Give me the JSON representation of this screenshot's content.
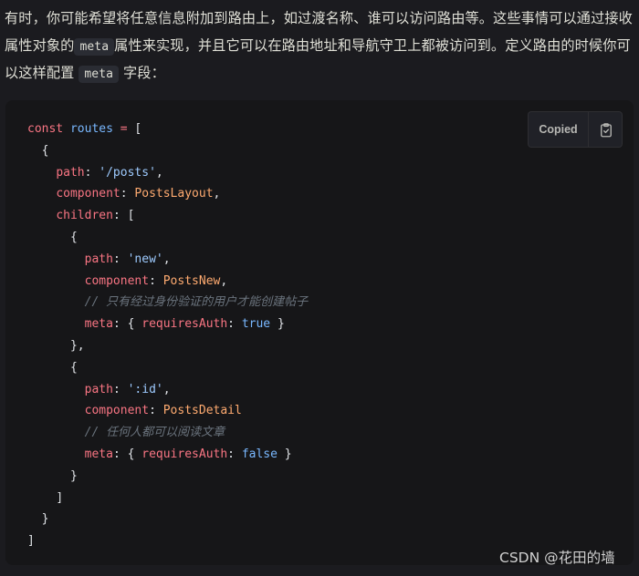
{
  "intro": {
    "line1_part1": "有时，你可能希望将任意信息附加到路由上，如过渡名称、谁可以访问路由等。这些事情可以通过接收属性对象的",
    "inline_code_1": "meta",
    "line2_part2": "属性来实现，并且它可以在路由地址和导航守卫上都被访问到。定义路由的时候你可以这样配置 ",
    "inline_code_2": "meta",
    "line3_part3": " 字段："
  },
  "code_block": {
    "copy_status": "Copied",
    "copy_icon": "clipboard-check-icon",
    "lines": [
      {
        "indent": "",
        "tokens": [
          [
            "kw",
            "const "
          ],
          [
            "var",
            "routes"
          ],
          [
            "op",
            " = "
          ],
          [
            "punc",
            "["
          ]
        ]
      },
      {
        "indent": "  ",
        "tokens": [
          [
            "punc",
            "{"
          ]
        ]
      },
      {
        "indent": "    ",
        "tokens": [
          [
            "key",
            "path"
          ],
          [
            "punc",
            ": "
          ],
          [
            "str",
            "'/posts'"
          ],
          [
            "punc",
            ","
          ]
        ]
      },
      {
        "indent": "    ",
        "tokens": [
          [
            "key",
            "component"
          ],
          [
            "punc",
            ": "
          ],
          [
            "val",
            "PostsLayout"
          ],
          [
            "punc",
            ","
          ]
        ]
      },
      {
        "indent": "    ",
        "tokens": [
          [
            "key",
            "children"
          ],
          [
            "punc",
            ": ["
          ]
        ]
      },
      {
        "indent": "      ",
        "tokens": [
          [
            "punc",
            "{"
          ]
        ]
      },
      {
        "indent": "        ",
        "tokens": [
          [
            "key",
            "path"
          ],
          [
            "punc",
            ": "
          ],
          [
            "str",
            "'new'"
          ],
          [
            "punc",
            ","
          ]
        ]
      },
      {
        "indent": "        ",
        "tokens": [
          [
            "key",
            "component"
          ],
          [
            "punc",
            ": "
          ],
          [
            "val",
            "PostsNew"
          ],
          [
            "punc",
            ","
          ]
        ]
      },
      {
        "indent": "        ",
        "tokens": [
          [
            "comment",
            "// 只有经过身份验证的用户才能创建帖子"
          ]
        ]
      },
      {
        "indent": "        ",
        "tokens": [
          [
            "key",
            "meta"
          ],
          [
            "punc",
            ": { "
          ],
          [
            "key",
            "requiresAuth"
          ],
          [
            "punc",
            ": "
          ],
          [
            "bool",
            "true"
          ],
          [
            "punc",
            " }"
          ]
        ]
      },
      {
        "indent": "      ",
        "tokens": [
          [
            "punc",
            "},"
          ]
        ]
      },
      {
        "indent": "      ",
        "tokens": [
          [
            "punc",
            "{"
          ]
        ]
      },
      {
        "indent": "        ",
        "tokens": [
          [
            "key",
            "path"
          ],
          [
            "punc",
            ": "
          ],
          [
            "str",
            "':id'"
          ],
          [
            "punc",
            ","
          ]
        ]
      },
      {
        "indent": "        ",
        "tokens": [
          [
            "key",
            "component"
          ],
          [
            "punc",
            ": "
          ],
          [
            "val",
            "PostsDetail"
          ]
        ]
      },
      {
        "indent": "        ",
        "tokens": [
          [
            "comment",
            "// 任何人都可以阅读文章"
          ]
        ]
      },
      {
        "indent": "        ",
        "tokens": [
          [
            "key",
            "meta"
          ],
          [
            "punc",
            ": { "
          ],
          [
            "key",
            "requiresAuth"
          ],
          [
            "punc",
            ": "
          ],
          [
            "bool",
            "false"
          ],
          [
            "punc",
            " }"
          ]
        ]
      },
      {
        "indent": "      ",
        "tokens": [
          [
            "punc",
            "}"
          ]
        ]
      },
      {
        "indent": "    ",
        "tokens": [
          [
            "punc",
            "]"
          ]
        ]
      },
      {
        "indent": "  ",
        "tokens": [
          [
            "punc",
            "}"
          ]
        ]
      },
      {
        "indent": "",
        "tokens": [
          [
            "punc",
            "]"
          ]
        ]
      }
    ]
  },
  "watermark": "CSDN @花田的墙",
  "colors": {
    "background": "#1b1b1f",
    "code_background": "#161618",
    "text": "#dfdfd6",
    "keyword": "#f97583",
    "string": "#9ecbff",
    "component_value": "#ffab70",
    "boolean": "#79b8ff",
    "comment": "#6a737d"
  }
}
